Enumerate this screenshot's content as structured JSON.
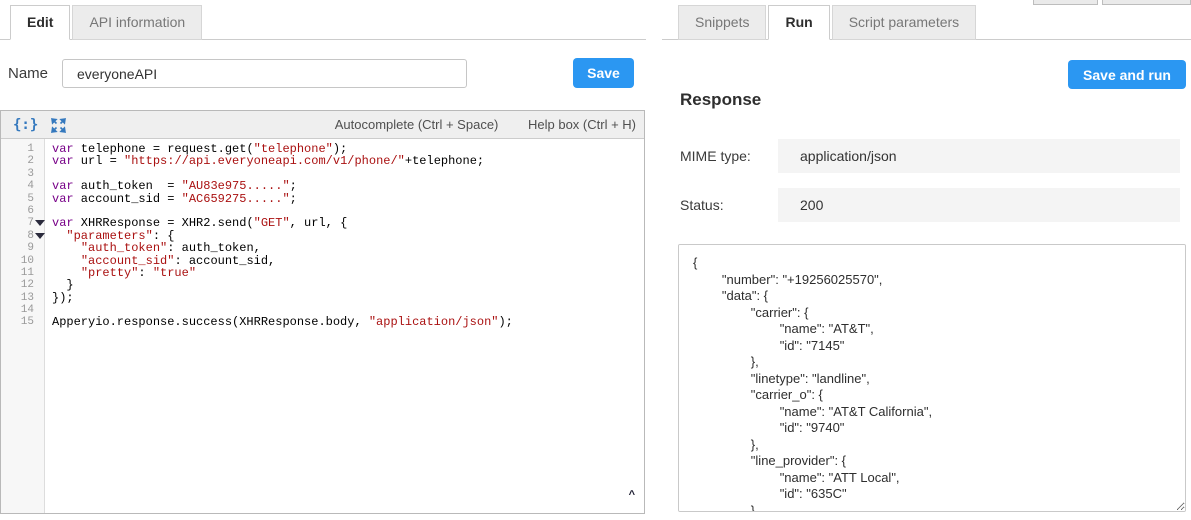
{
  "left_panel": {
    "tabs": [
      {
        "label": "Edit",
        "active": true
      },
      {
        "label": "API information",
        "active": false
      }
    ],
    "name_label": "Name",
    "name_value": "everyoneAPI",
    "save_button_label": "Save",
    "editor": {
      "toolbar": {
        "format_icon_glyph": "{:}",
        "autocomplete_hint": "Autocomplete (Ctrl + Space)",
        "helpbox_hint": "Help box (Ctrl + H)"
      },
      "fold_lines": [
        7,
        8
      ],
      "scroll_caret_glyph": "^",
      "syntax_colors": {
        "keyword": "#770088",
        "string": "#aa1111",
        "plain": "#000000"
      },
      "code_lines": [
        [
          [
            "k",
            "var"
          ],
          [
            "p",
            " telephone = request.get("
          ],
          [
            "s",
            "\"telephone\""
          ],
          [
            "p",
            ");"
          ]
        ],
        [
          [
            "k",
            "var"
          ],
          [
            "p",
            " url = "
          ],
          [
            "s",
            "\"https://api.everyoneapi.com/v1/phone/\""
          ],
          [
            "p",
            "+telephone;"
          ]
        ],
        [],
        [
          [
            "k",
            "var"
          ],
          [
            "p",
            " auth_token  = "
          ],
          [
            "s",
            "\"AU83e975.....\""
          ],
          [
            "p",
            ";"
          ]
        ],
        [
          [
            "k",
            "var"
          ],
          [
            "p",
            " account_sid = "
          ],
          [
            "s",
            "\"AC659275.....\""
          ],
          [
            "p",
            ";"
          ]
        ],
        [],
        [
          [
            "k",
            "var"
          ],
          [
            "p",
            " XHRResponse = XHR2.send("
          ],
          [
            "s",
            "\"GET\""
          ],
          [
            "p",
            ", url, {"
          ]
        ],
        [
          [
            "p",
            "  "
          ],
          [
            "s",
            "\"parameters\""
          ],
          [
            "p",
            ": {"
          ]
        ],
        [
          [
            "p",
            "    "
          ],
          [
            "s",
            "\"auth_token\""
          ],
          [
            "p",
            ": auth_token,"
          ]
        ],
        [
          [
            "p",
            "    "
          ],
          [
            "s",
            "\"account_sid\""
          ],
          [
            "p",
            ": account_sid,"
          ]
        ],
        [
          [
            "p",
            "    "
          ],
          [
            "s",
            "\"pretty\""
          ],
          [
            "p",
            ": "
          ],
          [
            "s",
            "\"true\""
          ]
        ],
        [
          [
            "p",
            "  }"
          ]
        ],
        [
          [
            "p",
            "});"
          ]
        ],
        [],
        [
          [
            "p",
            "Apperyio.response.success(XHRResponse.body, "
          ],
          [
            "s",
            "\"application/json\""
          ],
          [
            "p",
            ");"
          ]
        ]
      ]
    }
  },
  "right_panel": {
    "tabs": [
      {
        "label": "Snippets",
        "active": false
      },
      {
        "label": "Run",
        "active": true
      },
      {
        "label": "Script parameters",
        "active": false
      }
    ],
    "save_and_run_button_label": "Save and run",
    "response_heading": "Response",
    "mime_label": "MIME type:",
    "mime_value": "application/json",
    "status_label": "Status:",
    "status_value": "200",
    "response_body": "{\n\t\"number\": \"+19256025570\",\n\t\"data\": {\n\t\t\"carrier\": {\n\t\t\t\"name\": \"AT&T\",\n\t\t\t\"id\": \"7145\"\n\t\t},\n\t\t\"linetype\": \"landline\",\n\t\t\"carrier_o\": {\n\t\t\t\"name\": \"AT&T California\",\n\t\t\t\"id\": \"9740\"\n\t\t},\n\t\t\"line_provider\": {\n\t\t\t\"name\": \"ATT Local\",\n\t\t\t\"id\": \"635C\"\n\t\t},"
  },
  "colors": {
    "accent_blue": "#2b97f2",
    "tab_inactive_bg": "#ececec",
    "field_bg": "#f4f4f4",
    "toolbar_bg": "#efefef",
    "toolbar_icon_blue": "#3579be"
  }
}
